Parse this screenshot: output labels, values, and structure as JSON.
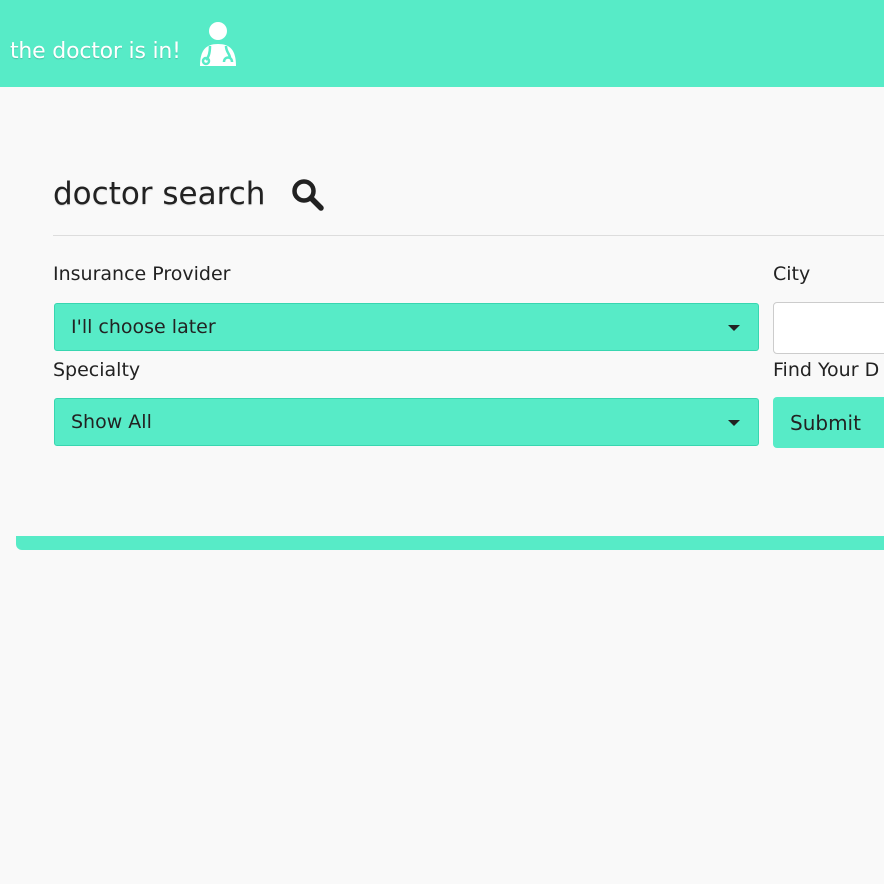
{
  "navbar": {
    "brand_text": "the doctor is in!",
    "brand_icon": "doctor-stethoscope-icon",
    "background_color": "#57ebc7"
  },
  "search": {
    "heading": "doctor search",
    "heading_icon": "search-icon",
    "insurance": {
      "label": "Insurance Provider",
      "selected": "I'll choose later"
    },
    "city": {
      "label": "City",
      "value": ""
    },
    "specialty": {
      "label": "Specialty",
      "selected": "Show All"
    },
    "find": {
      "label": "Find Your D",
      "button_label": "Submit"
    }
  },
  "colors": {
    "accent": "#57ebc7",
    "background": "#f9f9f9",
    "text": "#222222"
  }
}
